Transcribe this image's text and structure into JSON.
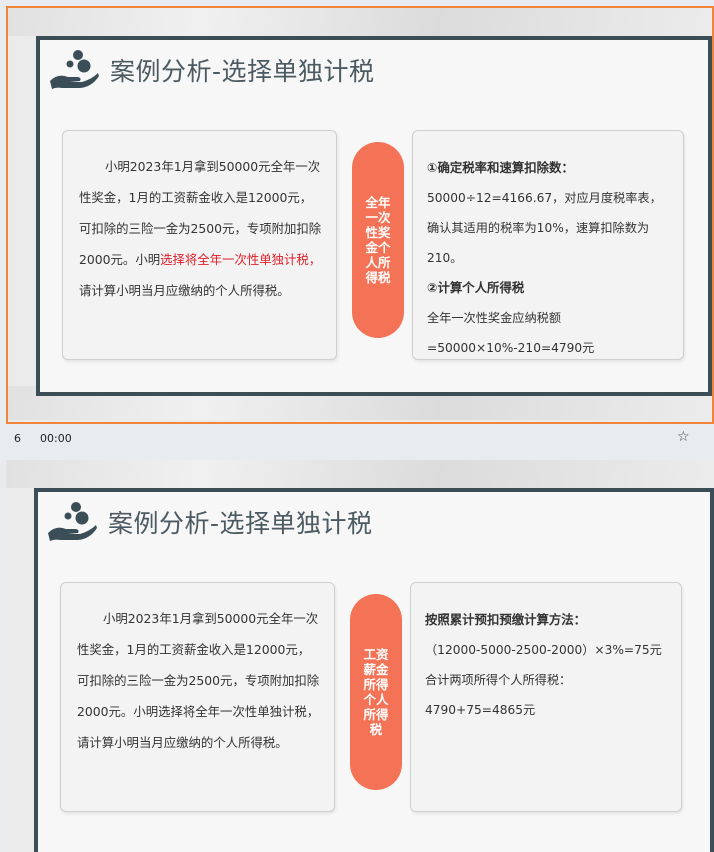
{
  "slide_a": {
    "title": "案例分析-选择单独计税",
    "story_part1": "小明2023年1月拿到50000元全年一次性奖金，1月的工资薪金收入是12000元，可扣除的三险一金为2500元，专项附加扣除2000元。小明",
    "story_highlight": "选择将全年一次性单独计税，",
    "story_part2": "请计算小明当月应缴纳的个人所得税。",
    "pill": "全年一次性奖金个人所得税",
    "right": {
      "head1": "①确定税率和速算扣除数：",
      "line1": "50000÷12=4166.67，对应月度税率表，确认其适用的税率为10%，速算扣除数为210。",
      "head2": "②计算个人所得税",
      "line2": "全年一次性奖金应纳税额=50000×10%-210=4790元"
    }
  },
  "status": {
    "slide_number": "6",
    "time": "00:00",
    "star": "☆"
  },
  "slide_b": {
    "title": "案例分析-选择单独计税",
    "story": "小明2023年1月拿到50000元全年一次性奖金，1月的工资薪金收入是12000元，可扣除的三险一金为2500元，专项附加扣除2000元。小明选择将全年一次性单独计税，请计算小明当月应缴纳的个人所得税。",
    "pill": "工资薪金所得个人所得税",
    "right": {
      "head1": "按照累计预扣预缴计算方法：",
      "line1": "（12000-5000-2500-2000）×3%=75元",
      "line2": "合计两项所得个人所得税：",
      "line3": "4790+75=4865元"
    }
  },
  "colors": {
    "frame": "#3b4e57",
    "pill": "#f47255",
    "highlight": "#e0202a",
    "selection": "#f0853a"
  }
}
